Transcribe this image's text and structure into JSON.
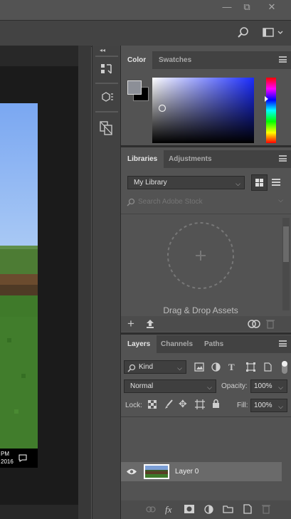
{
  "window": {
    "minimize": "—",
    "restore": "⧉",
    "close": "✕"
  },
  "color_panel": {
    "tabs": [
      "Color",
      "Swatches"
    ]
  },
  "libraries_panel": {
    "tabs": [
      "Libraries",
      "Adjustments"
    ],
    "library_name": "My Library",
    "search_placeholder": "Search Adobe Stock",
    "drop_text": "Drag & Drop Assets"
  },
  "layers_panel": {
    "tabs": [
      "Layers",
      "Channels",
      "Paths"
    ],
    "filter_kind": "Kind",
    "blend_mode": "Normal",
    "opacity_label": "Opacity:",
    "opacity_value": "100%",
    "lock_label": "Lock:",
    "fill_label": "Fill:",
    "fill_value": "100%",
    "layers": [
      {
        "name": "Layer 0",
        "visible": true
      }
    ]
  },
  "taskbar": {
    "time": "PM",
    "date": "2016"
  },
  "icons": [
    "search-icon",
    "workspace-icon",
    "history-icon",
    "properties-icon",
    "info-icon",
    "eye-icon",
    "link-icon",
    "fx-icon",
    "mask-icon",
    "adjustment-icon",
    "folder-icon",
    "new-layer-icon",
    "trash-icon"
  ]
}
